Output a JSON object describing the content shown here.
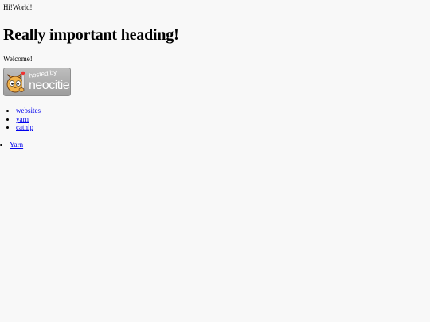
{
  "top_text": "Hi!World!",
  "heading": "Really important heading!",
  "welcome": "Welcome!",
  "badge": {
    "hosted_label": "hosted by",
    "brand_label": "neocities",
    "logo": "neocities-cat-logo"
  },
  "links": [
    {
      "label": "websites"
    },
    {
      "label": "yarn"
    },
    {
      "label": "catnip"
    }
  ],
  "links2": [
    {
      "label": "Yarn"
    }
  ],
  "colors": {
    "background": "#f8f8f8",
    "link": "#0000ee",
    "badge": "#a8a8a8"
  }
}
